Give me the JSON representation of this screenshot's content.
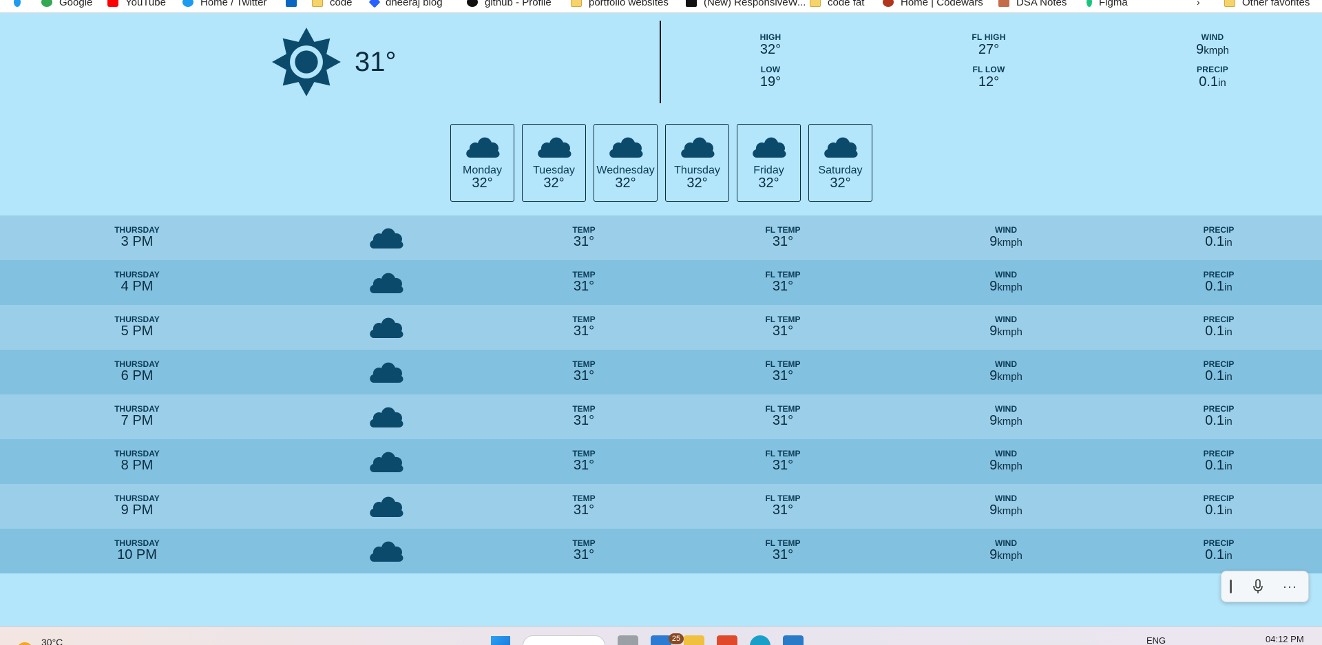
{
  "bookmarks": [
    {
      "label": "Google",
      "icon": "google-icon"
    },
    {
      "label": "YouTube",
      "icon": "youtube-icon"
    },
    {
      "label": "Home / Twitter",
      "icon": "twitter-icon"
    },
    {
      "label": "",
      "icon": "linkedin-icon"
    },
    {
      "label": "code",
      "icon": "folder-icon"
    },
    {
      "label": "dheeraj blog",
      "icon": "hashnode-icon"
    },
    {
      "label": "github - Profile",
      "icon": "github-icon"
    },
    {
      "label": "portfolio websites",
      "icon": "folder-icon"
    },
    {
      "label": "(New) ResponsiveW...",
      "icon": "responsive-icon"
    },
    {
      "label": "code fat",
      "icon": "folder-icon"
    },
    {
      "label": "Home | Codewars",
      "icon": "codewars-icon"
    },
    {
      "label": "DSA Notes",
      "icon": "notes-icon"
    },
    {
      "label": "Figma",
      "icon": "figma-icon"
    },
    {
      "label": "Other favorites",
      "icon": "folder-icon"
    }
  ],
  "current": {
    "icon": "sun-icon",
    "temp": "31°",
    "high_label": "HIGH",
    "high": "32°",
    "low_label": "LOW",
    "low": "19°",
    "fl_high_label": "FL HIGH",
    "fl_high": "27°",
    "fl_low_label": "FL LOW",
    "fl_low": "12°",
    "wind_label": "WIND",
    "wind": "9",
    "wind_unit": "kmph",
    "precip_label": "PRECIP",
    "precip": "0.1",
    "precip_unit": "in"
  },
  "days": [
    {
      "name": "Monday",
      "temp": "32°",
      "icon": "cloud-icon"
    },
    {
      "name": "Tuesday",
      "temp": "32°",
      "icon": "cloud-icon"
    },
    {
      "name": "Wednesday",
      "temp": "32°",
      "icon": "cloud-icon"
    },
    {
      "name": "Thursday",
      "temp": "32°",
      "icon": "cloud-icon"
    },
    {
      "name": "Friday",
      "temp": "32°",
      "icon": "cloud-icon"
    },
    {
      "name": "Saturday",
      "temp": "32°",
      "icon": "cloud-icon"
    }
  ],
  "hour_labels": {
    "temp": "TEMP",
    "fl_temp": "FL TEMP",
    "wind": "WIND",
    "precip": "PRECIP"
  },
  "hours": [
    {
      "day": "THURSDAY",
      "time": "3 PM",
      "temp": "31°",
      "fl_temp": "31°",
      "wind": "9",
      "wind_unit": "kmph",
      "precip": "0.1",
      "precip_unit": "in"
    },
    {
      "day": "THURSDAY",
      "time": "4 PM",
      "temp": "31°",
      "fl_temp": "31°",
      "wind": "9",
      "wind_unit": "kmph",
      "precip": "0.1",
      "precip_unit": "in"
    },
    {
      "day": "THURSDAY",
      "time": "5 PM",
      "temp": "31°",
      "fl_temp": "31°",
      "wind": "9",
      "wind_unit": "kmph",
      "precip": "0.1",
      "precip_unit": "in"
    },
    {
      "day": "THURSDAY",
      "time": "6 PM",
      "temp": "31°",
      "fl_temp": "31°",
      "wind": "9",
      "wind_unit": "kmph",
      "precip": "0.1",
      "precip_unit": "in"
    },
    {
      "day": "THURSDAY",
      "time": "7 PM",
      "temp": "31°",
      "fl_temp": "31°",
      "wind": "9",
      "wind_unit": "kmph",
      "precip": "0.1",
      "precip_unit": "in"
    },
    {
      "day": "THURSDAY",
      "time": "8 PM",
      "temp": "31°",
      "fl_temp": "31°",
      "wind": "9",
      "wind_unit": "kmph",
      "precip": "0.1",
      "precip_unit": "in"
    },
    {
      "day": "THURSDAY",
      "time": "9 PM",
      "temp": "31°",
      "fl_temp": "31°",
      "wind": "9",
      "wind_unit": "kmph",
      "precip": "0.1",
      "precip_unit": "in"
    },
    {
      "day": "THURSDAY",
      "time": "10 PM",
      "temp": "31°",
      "fl_temp": "31°",
      "wind": "9",
      "wind_unit": "kmph",
      "precip": "0.1",
      "precip_unit": "in"
    }
  ],
  "voice_widget": {
    "more": "···"
  },
  "taskbar": {
    "weather_temp": "30°C",
    "mail_badge": "25",
    "language": "ENG",
    "time": "04:12 PM"
  },
  "colors": {
    "background": "#b3e5fb",
    "icon": "#0b4a6b",
    "row_odd": "#9bcfe9",
    "row_even": "#82c1df"
  }
}
